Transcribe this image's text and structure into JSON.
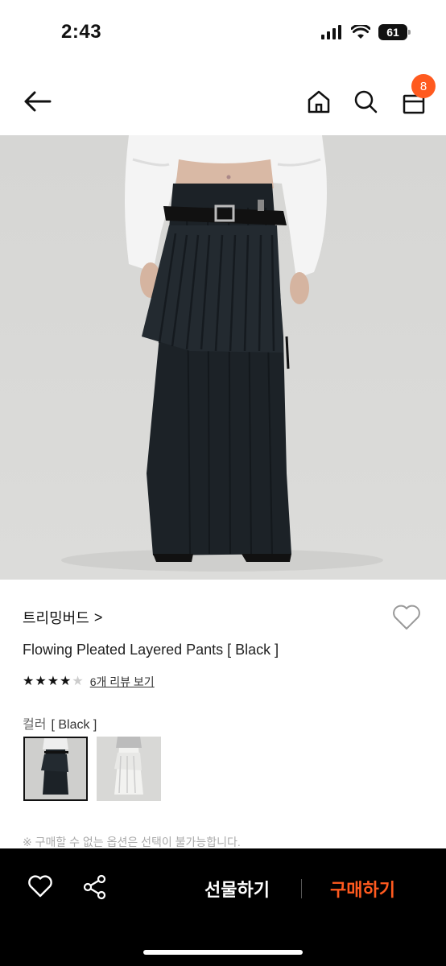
{
  "status_bar": {
    "time": "2:43",
    "battery": "61"
  },
  "header": {
    "cart_count": "8",
    "icons": [
      "back-arrow-icon",
      "home-icon",
      "search-icon",
      "shopping-bag-icon"
    ]
  },
  "product": {
    "brand": "트리밍버드",
    "brand_chevron": ">",
    "title": "Flowing Pleated Layered Pants [ Black ]",
    "rating": 4,
    "max_rating": 5,
    "review_link": "6개 리뷰 보기",
    "option_label": "컬러",
    "option_value": "[ Black ]",
    "swatches": [
      {
        "name": "Black",
        "selected": true
      },
      {
        "name": "White",
        "selected": false
      }
    ],
    "notice": "※ 구매할 수 없는 옵션은 선택이 불가능합니다."
  },
  "bottom_bar": {
    "gift_label": "선물하기",
    "buy_label": "구매하기"
  },
  "colors": {
    "accent": "#ff5a1f",
    "bottom_bar_bg": "#000000"
  }
}
